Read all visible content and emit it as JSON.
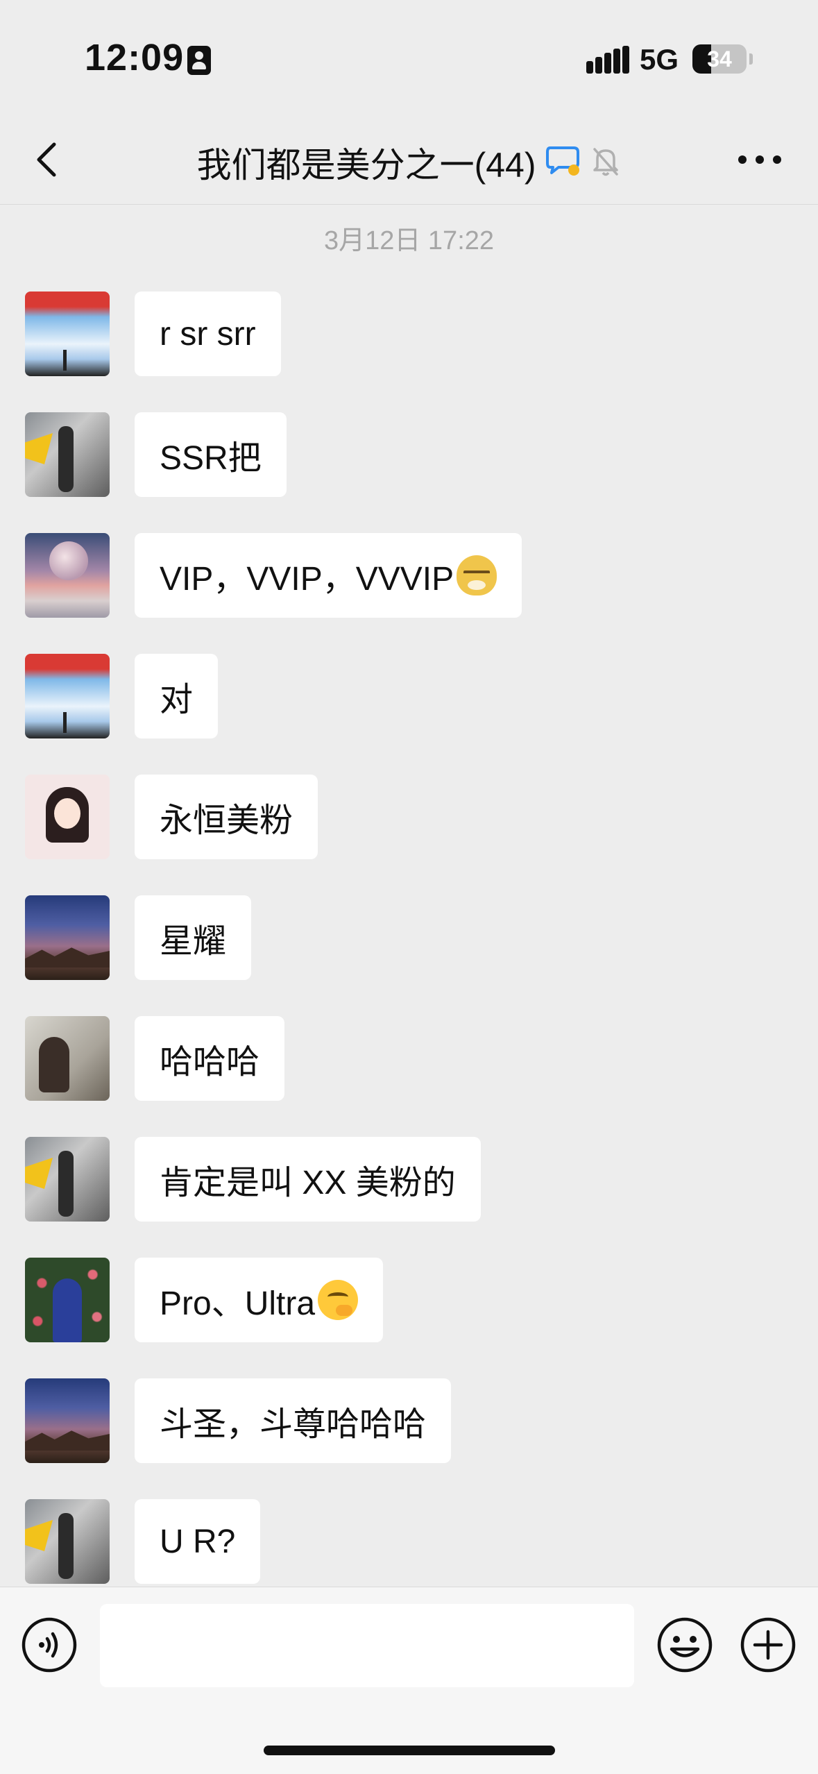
{
  "status_bar": {
    "time": "12:09",
    "network": "5G",
    "battery_percent": "34",
    "battery_level": 0.34
  },
  "nav": {
    "title": "我们都是美分之一(44)",
    "back_icon": "chevron-left-icon",
    "more_icon": "more-dots-icon",
    "status_icons": [
      "chat-bubble-icon",
      "muted-bell-icon"
    ]
  },
  "chat": {
    "timestamp": "3月12日 17:22",
    "messages": [
      {
        "avatar": "sky-tower",
        "text": "r sr srr"
      },
      {
        "avatar": "man-posing",
        "text": "SSR把"
      },
      {
        "avatar": "planet-lake",
        "text": "VIP，VVIP，VVVIP",
        "emoji": "doge-sunglasses"
      },
      {
        "avatar": "sky-tower",
        "text": "对"
      },
      {
        "avatar": "cartoon-girl",
        "text": "永恒美粉"
      },
      {
        "avatar": "starry-mountains",
        "text": "星耀"
      },
      {
        "avatar": "woman-reading",
        "text": "哈哈哈"
      },
      {
        "avatar": "man-posing",
        "text": "肯定是叫 XX 美粉的"
      },
      {
        "avatar": "woman-flowers",
        "text": "Pro、Ultra",
        "emoji": "thinking-face"
      },
      {
        "avatar": "starry-mountains",
        "text": "斗圣，斗尊哈哈哈"
      },
      {
        "avatar": "man-posing",
        "text": "U R?"
      }
    ]
  },
  "input_bar": {
    "input_value": "",
    "voice_icon": "voice-icon",
    "emoji_icon": "smiley-icon",
    "plus_icon": "plus-circle-icon"
  },
  "colors": {
    "background": "#ededed",
    "bubble": "#ffffff",
    "timestamp": "#a6a6a6",
    "accent_blue": "#2f8cf0",
    "accent_yellow": "#f3b61f"
  }
}
